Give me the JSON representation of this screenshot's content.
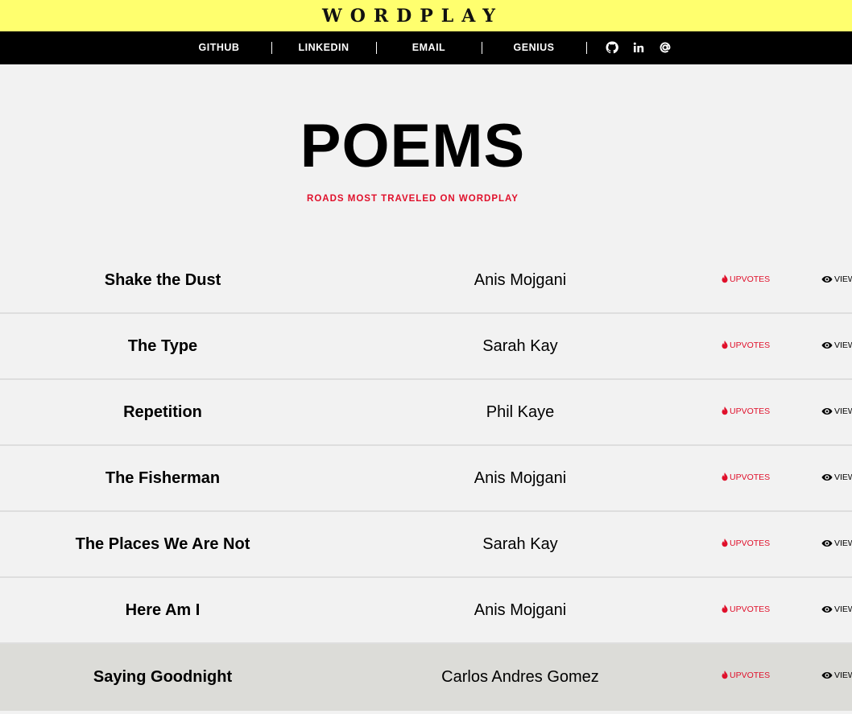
{
  "header": {
    "logo": "WORDPLAY"
  },
  "nav": {
    "links": [
      "GITHUB",
      "LINKEDIN",
      "EMAIL",
      "GENIUS"
    ],
    "icons": [
      "github-icon",
      "linkedin-icon",
      "at-sign-icon"
    ]
  },
  "page": {
    "title": "POEMS",
    "subtitle": "ROADS MOST TRAVELED ON WORDPLAY"
  },
  "colors": {
    "accent_yellow": "#ffff6e",
    "accent_red": "#e0102b",
    "nav_bg": "#000000"
  },
  "table": {
    "upvotes_label": "UPVOTES",
    "views_label": "VIEW",
    "rows": [
      {
        "poem": "Shake the Dust",
        "author": "Anis Mojgani"
      },
      {
        "poem": "The Type",
        "author": "Sarah Kay"
      },
      {
        "poem": "Repetition",
        "author": "Phil Kaye"
      },
      {
        "poem": "The Fisherman",
        "author": "Anis Mojgani"
      },
      {
        "poem": "The Places We Are Not",
        "author": "Sarah Kay"
      },
      {
        "poem": "Here Am I",
        "author": "Anis Mojgani"
      },
      {
        "poem": "Saying Goodnight",
        "author": "Carlos Andres Gomez"
      }
    ]
  }
}
